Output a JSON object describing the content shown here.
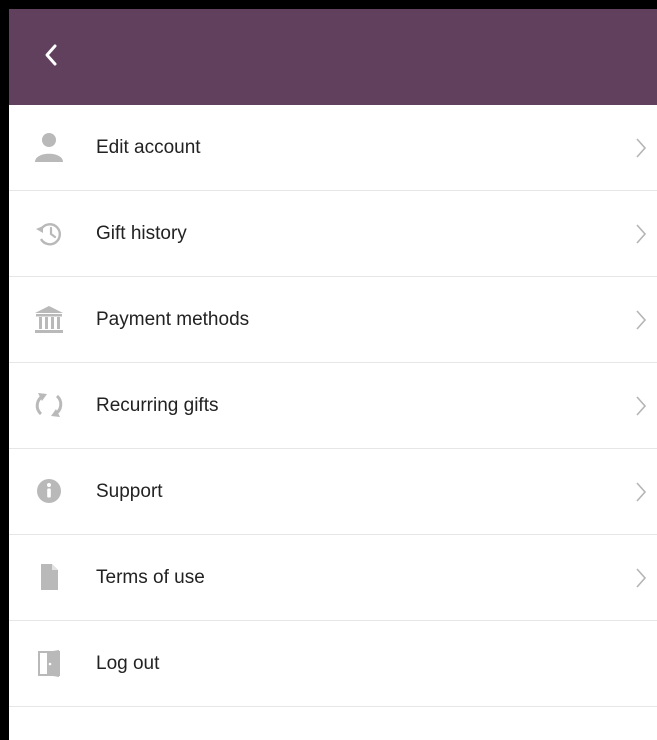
{
  "header": {
    "back_icon": "chevron-left-icon",
    "background": "#61405e"
  },
  "menu": {
    "items": [
      {
        "label": "Edit account",
        "icon": "person-icon",
        "has_chevron": true
      },
      {
        "label": "Gift history",
        "icon": "history-icon",
        "has_chevron": true
      },
      {
        "label": "Payment methods",
        "icon": "bank-icon",
        "has_chevron": true
      },
      {
        "label": "Recurring gifts",
        "icon": "refresh-icon",
        "has_chevron": true
      },
      {
        "label": "Support",
        "icon": "info-icon",
        "has_chevron": true
      },
      {
        "label": "Terms of use",
        "icon": "document-icon",
        "has_chevron": true
      },
      {
        "label": "Log out",
        "icon": "door-icon",
        "has_chevron": false
      }
    ]
  },
  "colors": {
    "icon_gray": "#b9b9b9",
    "chevron_gray": "#b5b5b5",
    "divider": "#e6e6e6",
    "text": "#222222"
  }
}
